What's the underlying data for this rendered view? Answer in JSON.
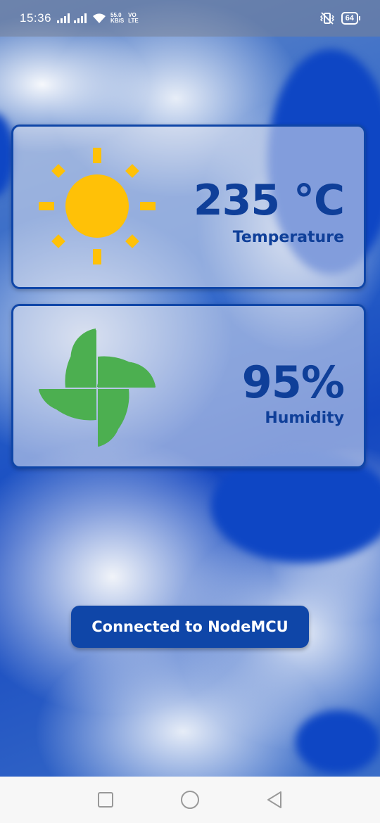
{
  "status_bar": {
    "time": "15:36",
    "net_speed_value": "55.0",
    "net_speed_unit": "KB/S",
    "volte_top": "VO",
    "volte_bottom": "LTE",
    "battery": "64"
  },
  "temperature_card": {
    "value": "235 °C",
    "label": "Temperature",
    "icon": "sun-icon"
  },
  "humidity_card": {
    "value": "95%",
    "label": "Humidity",
    "icon": "fan-icon"
  },
  "connection_button": {
    "label": "Connected to NodeMCU"
  },
  "nav_bar": {
    "items": [
      "recent-apps-icon",
      "home-icon",
      "back-icon"
    ]
  },
  "colors": {
    "accent": "#0f46a8",
    "text_blue": "#0f3f99",
    "sun": "#ffc107",
    "fan": "#4caf50"
  }
}
